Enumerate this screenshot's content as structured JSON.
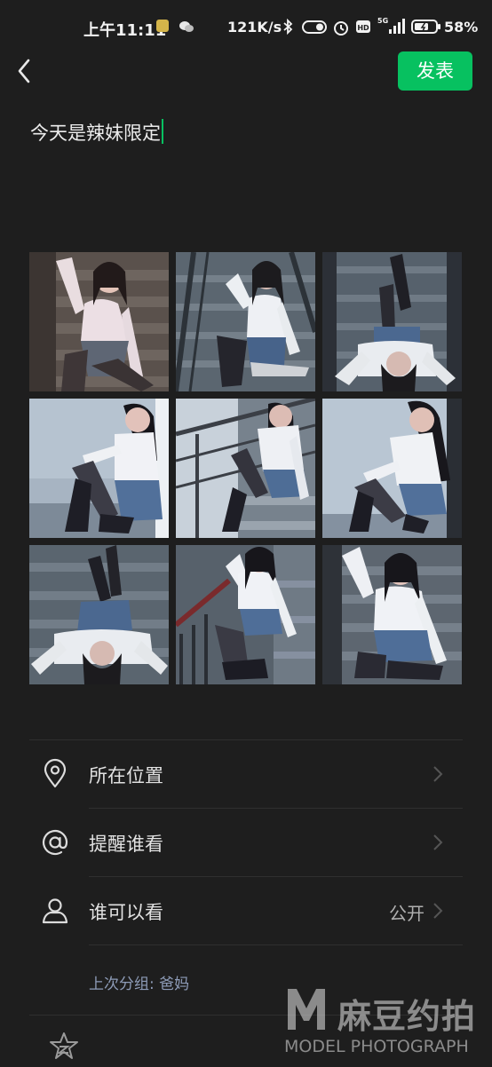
{
  "status_bar": {
    "time": "上午11:11",
    "network_speed": "121K/s",
    "network_type": "5G",
    "battery": "58%",
    "icons": [
      "app-badge-icon",
      "wechat-icon",
      "bluetooth-icon",
      "toggle-icon",
      "alarm-icon",
      "hd-icon",
      "signal-icon",
      "battery-icon"
    ]
  },
  "header": {
    "publish_label": "发表"
  },
  "post": {
    "text": "今天是辣妹限定"
  },
  "photos": [
    {
      "id": "photo-1"
    },
    {
      "id": "photo-2"
    },
    {
      "id": "photo-3"
    },
    {
      "id": "photo-4"
    },
    {
      "id": "photo-5"
    },
    {
      "id": "photo-6"
    },
    {
      "id": "photo-7"
    },
    {
      "id": "photo-8"
    },
    {
      "id": "photo-9"
    }
  ],
  "menu": {
    "location": {
      "label": "所在位置",
      "icon": "location-pin-icon"
    },
    "mention": {
      "label": "提醒谁看",
      "icon": "at-icon"
    },
    "visibility": {
      "label": "谁可以看",
      "value": "公开",
      "icon": "person-icon"
    },
    "last_group": "上次分组: 爸妈"
  },
  "watermark": {
    "cn": "麻豆约拍",
    "en": "MODEL PHOTOGRAPH"
  },
  "colors": {
    "accent": "#07c160",
    "background": "#1e1e1e",
    "group_text": "#8e9cb8"
  }
}
